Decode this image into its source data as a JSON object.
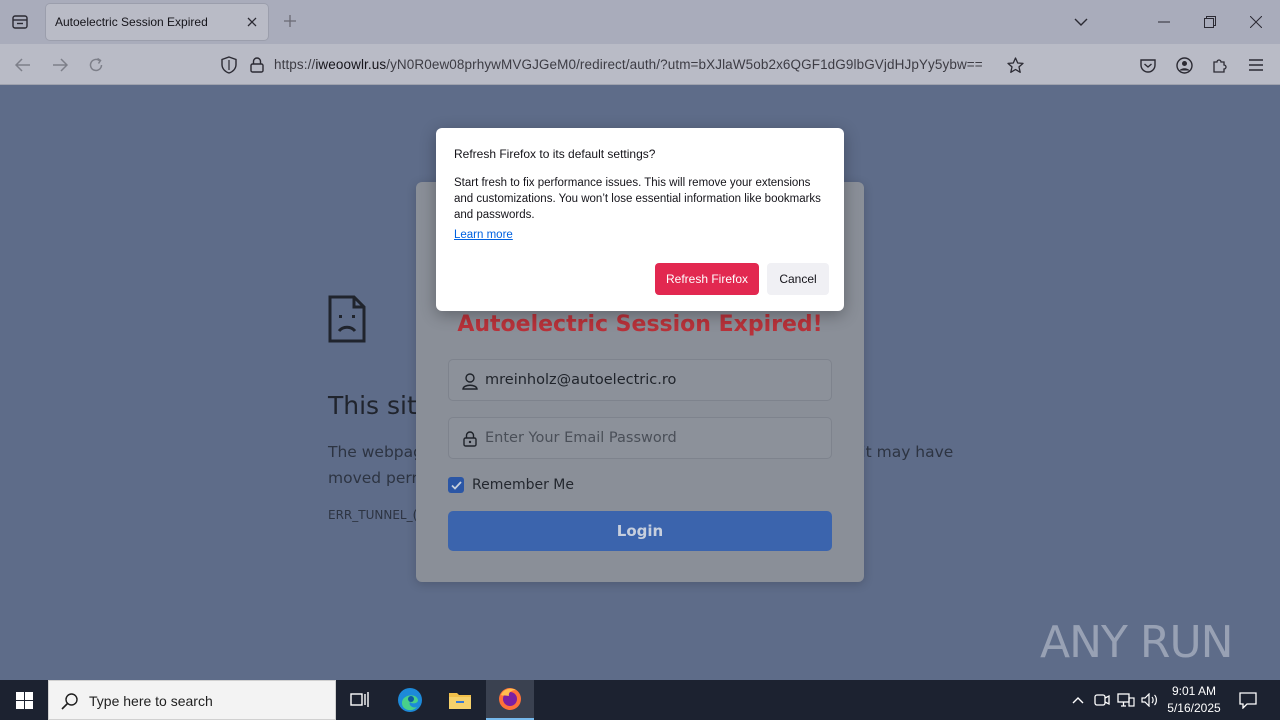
{
  "browser": {
    "tab_title": "Autoelectric Session Expired",
    "url_prefix": "https://",
    "url_host": "iweoowlr.us",
    "url_rest": "/yN0R0ew08prhywMVGJGeM0/redirect/auth/?utm=bXJlaW5ob2x6QGF1dG9lbGVjdHJpYy5ybw=="
  },
  "error_page": {
    "title": "This sit",
    "text_line1": "The webpag",
    "text_line2": "moved perr",
    "text_line3_tail": "r it may have",
    "code": "ERR_TUNNEL_("
  },
  "login": {
    "heading": "Autoelectric Session Expired!",
    "email_value": "mreinholz@autoelectric.ro",
    "password_placeholder": "Enter Your Email Password",
    "remember_label": "Remember Me",
    "remember_checked": true,
    "login_button": "Login"
  },
  "dialog": {
    "title": "Refresh Firefox to its default settings?",
    "body": "Start fresh to fix performance issues. This will remove your extensions and customizations. You won’t lose essential information like bookmarks and passwords.",
    "learn_more": "Learn more",
    "primary_button": "Refresh Firefox",
    "cancel_button": "Cancel"
  },
  "watermark": {
    "text": "ANY RUN"
  },
  "taskbar": {
    "search_placeholder": "Type here to search",
    "time": "9:01 AM",
    "date": "5/16/2025"
  },
  "colors": {
    "accent_red": "#e22850",
    "heading_red": "#b8323a",
    "login_blue": "#3b64ad",
    "taskbar": "#1c2230"
  }
}
